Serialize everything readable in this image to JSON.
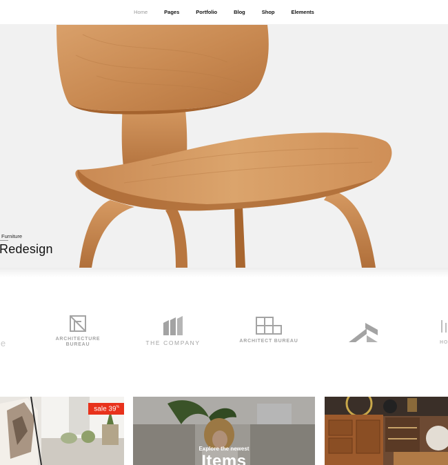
{
  "nav": {
    "items": [
      {
        "label": "Home",
        "active": true
      },
      {
        "label": "Pages",
        "active": false
      },
      {
        "label": "Portfolio",
        "active": false
      },
      {
        "label": "Blog",
        "active": false
      },
      {
        "label": "Shop",
        "active": false
      },
      {
        "label": "Elements",
        "active": false
      }
    ]
  },
  "hero": {
    "kicker": "Furniture",
    "title": "Redesign"
  },
  "logos": {
    "partial_left": "le",
    "architecture_bureau_line1": "ARCHITECTURE",
    "architecture_bureau_line2": "BUREAU",
    "the_company": "THE COMPANY",
    "architect_bureau": "ARCHITECT BUREAU",
    "partial_right": "HOU"
  },
  "products": {
    "sale_badge": "sale 39",
    "sale_suffix": "%",
    "featured_kicker": "Explore the newest",
    "featured_title": "Items"
  },
  "colors": {
    "accent_sale": "#e8321c",
    "hero_bg": "#f1f1f1",
    "logo_gray": "#a3a3a3"
  }
}
